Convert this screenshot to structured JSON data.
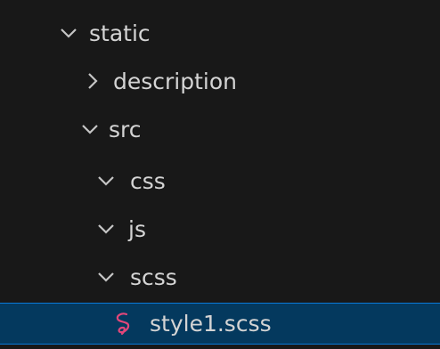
{
  "explorer": {
    "items": [
      {
        "label": "static",
        "expanded": true,
        "icon": "chevron-down-icon"
      },
      {
        "label": "description",
        "expanded": false,
        "icon": "chevron-right-icon"
      },
      {
        "label": "src",
        "expanded": true,
        "icon": "chevron-down-icon"
      },
      {
        "label": "css",
        "expanded": true,
        "icon": "chevron-down-icon"
      },
      {
        "label": "js",
        "expanded": true,
        "icon": "chevron-down-icon"
      },
      {
        "label": "scss",
        "expanded": true,
        "icon": "chevron-down-icon"
      },
      {
        "label": "style1.scss",
        "selected": true,
        "icon": "sass-file-icon"
      }
    ]
  },
  "colors": {
    "background": "#181818",
    "text": "#d4d4d4",
    "selection_bg": "#04395e",
    "selection_border": "#0a7ad8",
    "sass_icon": "#e2477a"
  }
}
